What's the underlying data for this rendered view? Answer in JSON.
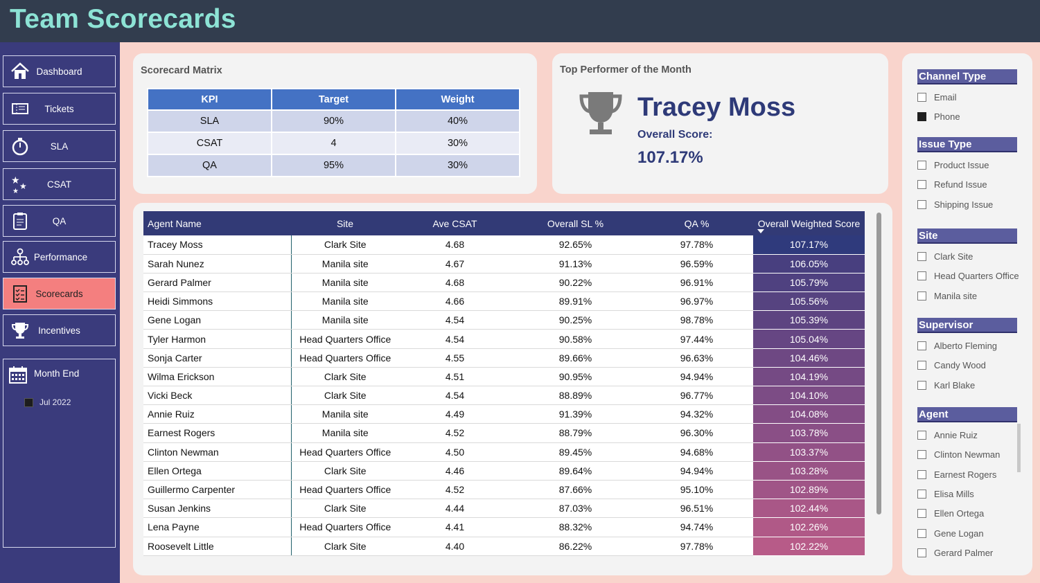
{
  "app": {
    "title": "Team Scorecards"
  },
  "nav": {
    "items": [
      {
        "label": "Dashboard",
        "icon": "home-icon"
      },
      {
        "label": "Tickets",
        "icon": "ticket-icon"
      },
      {
        "label": "SLA",
        "icon": "stopwatch-icon"
      },
      {
        "label": "CSAT",
        "icon": "stars-icon"
      },
      {
        "label": "QA",
        "icon": "clipboard-icon"
      },
      {
        "label": "Performance",
        "icon": "org-chart-icon"
      },
      {
        "label": "Scorecards",
        "icon": "checklist-icon",
        "active": true
      },
      {
        "label": "Incentives",
        "icon": "trophy-icon"
      }
    ],
    "month_end": {
      "title": "Month End",
      "value": "Jul 2022"
    }
  },
  "matrix": {
    "title": "Scorecard Matrix",
    "headers": [
      "KPI",
      "Target",
      "Weight"
    ],
    "rows": [
      [
        "SLA",
        "90%",
        "40%"
      ],
      [
        "CSAT",
        "4",
        "30%"
      ],
      [
        "QA",
        "95%",
        "30%"
      ]
    ]
  },
  "top_performer": {
    "title": "Top Performer of the Month",
    "name": "Tracey Moss",
    "score_label": "Overall Score:",
    "score": "107.17%"
  },
  "agents": {
    "headers": [
      "Agent Name",
      "Site",
      "Ave CSAT",
      "Overall SL %",
      "QA %",
      "Overall Weighted Score"
    ],
    "rows": [
      [
        "Tracey Moss",
        "Clark Site",
        "4.68",
        "92.65%",
        "97.78%",
        "107.17%"
      ],
      [
        "Sarah Nunez",
        "Manila site",
        "4.67",
        "91.13%",
        "96.59%",
        "106.05%"
      ],
      [
        "Gerard Palmer",
        "Manila site",
        "4.68",
        "90.22%",
        "96.91%",
        "105.79%"
      ],
      [
        "Heidi Simmons",
        "Manila site",
        "4.66",
        "89.91%",
        "96.97%",
        "105.56%"
      ],
      [
        "Gene Logan",
        "Manila site",
        "4.54",
        "90.25%",
        "98.78%",
        "105.39%"
      ],
      [
        "Tyler Harmon",
        "Head Quarters Office",
        "4.54",
        "90.58%",
        "97.44%",
        "105.04%"
      ],
      [
        "Sonja Carter",
        "Head Quarters Office",
        "4.55",
        "89.66%",
        "96.63%",
        "104.46%"
      ],
      [
        "Wilma Erickson",
        "Clark Site",
        "4.51",
        "90.95%",
        "94.94%",
        "104.19%"
      ],
      [
        "Vicki Beck",
        "Clark Site",
        "4.54",
        "88.89%",
        "96.77%",
        "104.10%"
      ],
      [
        "Annie Ruiz",
        "Manila site",
        "4.49",
        "91.39%",
        "94.32%",
        "104.08%"
      ],
      [
        "Earnest Rogers",
        "Manila site",
        "4.52",
        "88.79%",
        "96.30%",
        "103.78%"
      ],
      [
        "Clinton Newman",
        "Head Quarters Office",
        "4.50",
        "89.45%",
        "94.68%",
        "103.37%"
      ],
      [
        "Ellen Ortega",
        "Clark Site",
        "4.46",
        "89.64%",
        "94.94%",
        "103.28%"
      ],
      [
        "Guillermo Carpenter",
        "Head Quarters Office",
        "4.52",
        "87.66%",
        "95.10%",
        "102.89%"
      ],
      [
        "Susan Jenkins",
        "Clark Site",
        "4.44",
        "87.03%",
        "96.51%",
        "102.44%"
      ],
      [
        "Lena Payne",
        "Head Quarters Office",
        "4.41",
        "88.32%",
        "94.74%",
        "102.26%"
      ],
      [
        "Roosevelt Little",
        "Clark Site",
        "4.40",
        "86.22%",
        "97.78%",
        "102.22%"
      ]
    ],
    "score_colors": [
      "#2f3a7c",
      "#483f7f",
      "#4f4180",
      "#564380",
      "#5d4481",
      "#664683",
      "#6e4883",
      "#754a84",
      "#7c4c85",
      "#834d85",
      "#8a4f86",
      "#925186",
      "#995386",
      "#a05587",
      "#a95787",
      "#b05987",
      "#b75b88"
    ]
  },
  "filters": {
    "groups": [
      {
        "title": "Channel Type",
        "items": [
          {
            "label": "Email",
            "checked": false
          },
          {
            "label": "Phone",
            "checked": true
          }
        ]
      },
      {
        "title": "Issue Type",
        "items": [
          {
            "label": "Product Issue",
            "checked": false
          },
          {
            "label": "Refund Issue",
            "checked": false
          },
          {
            "label": "Shipping Issue",
            "checked": false
          }
        ]
      },
      {
        "title": "Site",
        "items": [
          {
            "label": "Clark Site",
            "checked": false
          },
          {
            "label": "Head Quarters Office",
            "checked": false
          },
          {
            "label": "Manila site",
            "checked": false
          }
        ]
      },
      {
        "title": "Supervisor",
        "items": [
          {
            "label": "Alberto Fleming",
            "checked": false
          },
          {
            "label": "Candy Wood",
            "checked": false
          },
          {
            "label": "Karl Blake",
            "checked": false
          }
        ]
      },
      {
        "title": "Agent",
        "items": [
          {
            "label": "Annie Ruiz",
            "checked": false
          },
          {
            "label": "Clinton Newman",
            "checked": false
          },
          {
            "label": "Earnest Rogers",
            "checked": false
          },
          {
            "label": "Elisa Mills",
            "checked": false
          },
          {
            "label": "Ellen Ortega",
            "checked": false
          },
          {
            "label": "Gene Logan",
            "checked": false
          },
          {
            "label": "Gerard Palmer",
            "checked": false
          }
        ]
      }
    ]
  }
}
